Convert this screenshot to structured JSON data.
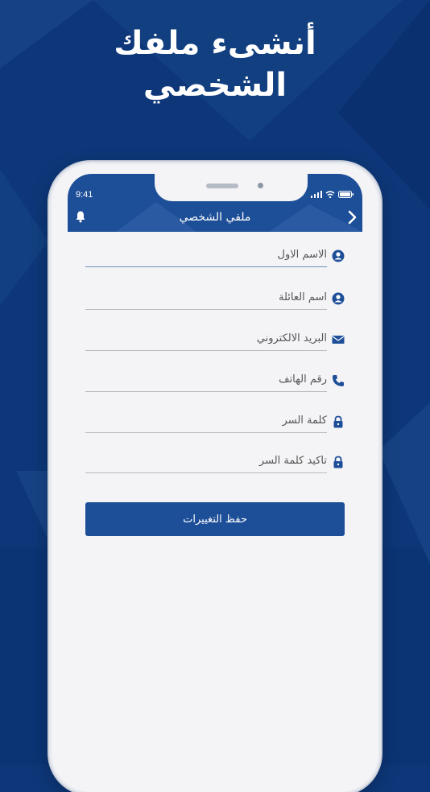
{
  "headline": {
    "line1": "أنشىء ملفك",
    "line2": "الشخصي"
  },
  "status_bar": {
    "time": "9:41"
  },
  "header": {
    "title": "ملفي الشخصي",
    "left_icon": "bell-icon",
    "right_icon": "chevron-right-icon"
  },
  "form": {
    "fields": [
      {
        "label": "الاسم الاول",
        "icon": "user-icon"
      },
      {
        "label": "اسم العائلة",
        "icon": "user-icon"
      },
      {
        "label": "البريد الالكتروني",
        "icon": "envelope-icon"
      },
      {
        "label": "رقم الهاتف",
        "icon": "phone-icon"
      },
      {
        "label": "كلمة السر",
        "icon": "lock-icon"
      },
      {
        "label": "تاكيد كلمة السر",
        "icon": "lock-icon"
      }
    ],
    "save_label": "حفظ التغييرات"
  },
  "colors": {
    "background": "#0d3778",
    "accent": "#1d4e98",
    "screen": "#f4f4f6"
  }
}
